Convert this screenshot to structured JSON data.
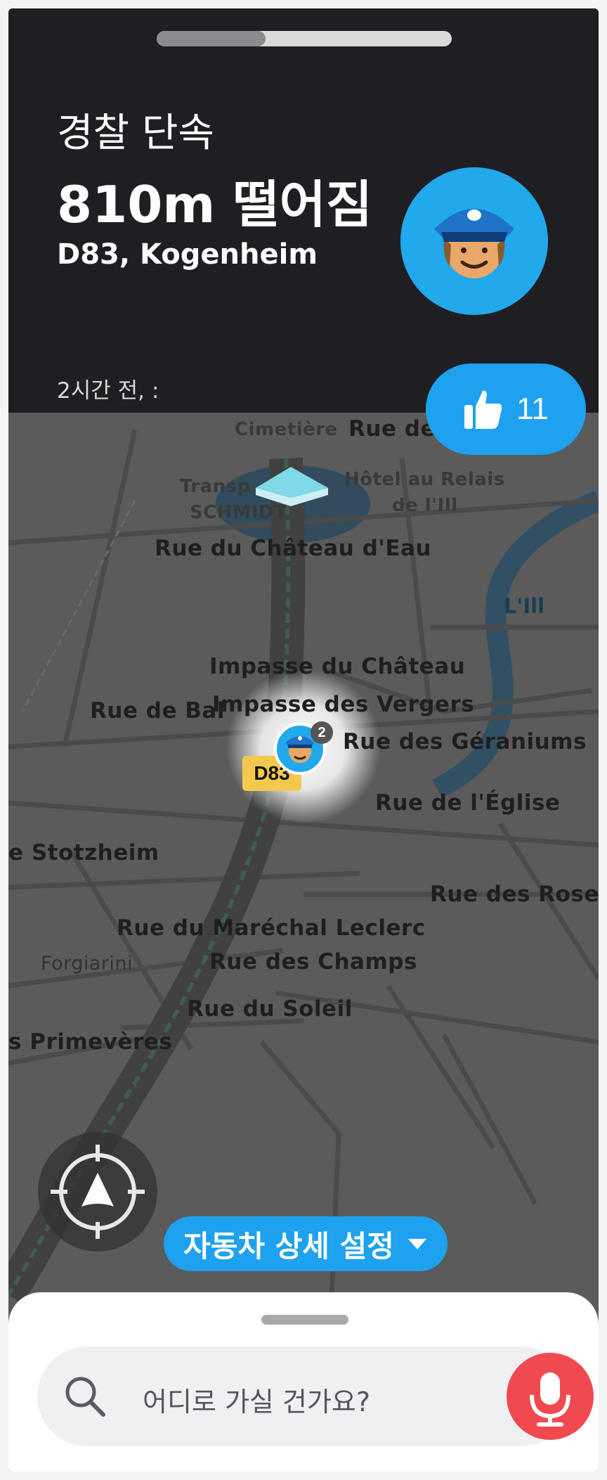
{
  "alert": {
    "type": "경찰 단속",
    "distance": "810m 떨어짐",
    "location": "D83, Kogenheim",
    "time": "2시간 전, :",
    "progress_fraction": 0.37,
    "icon": "police-officer-icon"
  },
  "thanks": {
    "count": "11",
    "icon": "thumbs-up-icon"
  },
  "map": {
    "streets": [
      "Cimetière",
      "Rue de",
      "Transp",
      "SCHMIDT",
      "Hôtel au Relais",
      "de l'Ill",
      "Rue du Château d'Eau",
      "L'Ill",
      "Impasse du Château",
      "Rue de Bal",
      "Impasse des Vergers",
      "Rue des Géraniums",
      "Rue de l'Église",
      "e Stotzheim",
      "Rue des Rose",
      "Rue du Maréchal Leclerc",
      "Forgiarini",
      "Rue des Champs",
      "Rue du Soleil",
      "s Primevères"
    ],
    "road_shield": "D83",
    "report_badge_count": "2"
  },
  "controls": {
    "car_settings_label": "자동차 상세 설정",
    "recenter_icon": "recenter-compass-icon"
  },
  "search": {
    "placeholder": "어디로 가실 건가요?",
    "search_icon": "search-icon",
    "mic_icon": "microphone-icon"
  },
  "colors": {
    "card_bg": "#1f1f23",
    "accent_blue": "#1ea1ee",
    "mic_red": "#f04a50",
    "map_overlay": "#5a5a5a"
  }
}
